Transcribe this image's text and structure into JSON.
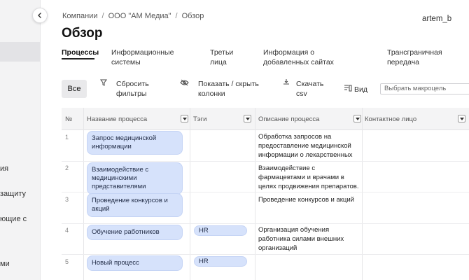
{
  "sidebar": {
    "items": [
      "ия",
      "защиту",
      "ющие с",
      "ми"
    ]
  },
  "breadcrumb": [
    "Компании",
    "ООО \"АМ Медиа\"",
    "Обзор"
  ],
  "breadcrumb_sep": "/",
  "user": {
    "name": "artem_b"
  },
  "page": {
    "title": "Обзор"
  },
  "tabs": [
    {
      "label": "Процессы"
    },
    {
      "label": "Информационные системы"
    },
    {
      "label": "Третьи лица"
    },
    {
      "label": "Информация о добавленных сайтах"
    },
    {
      "label": "Трансграничная передача"
    }
  ],
  "toolbar": {
    "all_label": "Все",
    "reset_filters": "Сбросить фильтры",
    "show_hide_columns": "Показать / скрыть колонки",
    "download_csv": "Скачать csv",
    "view": "Вид",
    "macro_placeholder": "Выбрать макроцель"
  },
  "table": {
    "headers": [
      "№",
      "Название процесса",
      "Тэги",
      "Описание процесса",
      "Контактное лицо"
    ],
    "rows": [
      {
        "num": "1",
        "name": "Запрос медицинской информации",
        "tag": "",
        "description": "Обработка запросов на предоставление медицинской информации о лекарственных"
      },
      {
        "num": "2",
        "name": "Взаимодействие с медицинскими представителями",
        "tag": "",
        "description": "Взаимодействие с фармацевтами и врачами в целях продвижения препаратов."
      },
      {
        "num": "3",
        "name": "Проведение конкурсов и акций",
        "tag": "",
        "description": "Проведение конкурсов и акций"
      },
      {
        "num": "4",
        "name": "Обучение работников",
        "tag": "HR",
        "description": "Организация обучения работника силами внешних организаций"
      },
      {
        "num": "5",
        "name": "Новый процесс",
        "tag": "HR",
        "description": ""
      }
    ]
  }
}
